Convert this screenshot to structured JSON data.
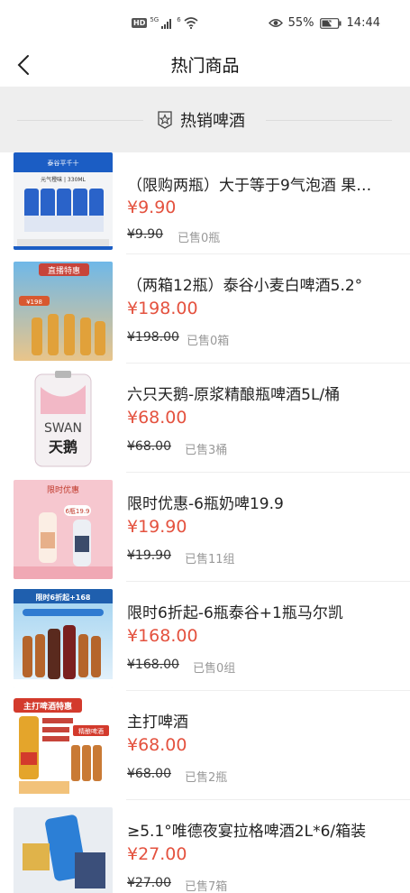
{
  "status_bar": {
    "hd": "HD",
    "network": "5G",
    "wifi_label": "6",
    "battery": "55%",
    "time": "14:44"
  },
  "header": {
    "title": "热门商品"
  },
  "section": {
    "title": "热销啤酒"
  },
  "thumbs": {
    "p1_top": "泰谷平千十",
    "p1_mid": "元气橙味 | 330ML",
    "p2_banner": "直播特惠",
    "p2_price": "¥198",
    "p3_brand": "SWAN",
    "p3_cn": "天鹅",
    "p4_banner": "限时优惠",
    "p4_price": "6瓶19.9",
    "p5_banner": "限时6折起+168",
    "p6_banner": "主打啤酒特惠",
    "p6_tag": "精酿啤酒"
  },
  "products": [
    {
      "title": "（限购两瓶）大于等于9气泡酒 果…",
      "price": "¥9.90",
      "original_price": "¥9.90",
      "sold": "已售0瓶"
    },
    {
      "title": "（两箱12瓶）泰谷小麦白啤酒5.2°",
      "price": "¥198.00",
      "original_price": "¥198.00",
      "sold": "已售0箱"
    },
    {
      "title": "六只天鹅-原浆精酿瓶啤酒5L/桶",
      "price": "¥68.00",
      "original_price": "¥68.00",
      "sold": "已售3桶"
    },
    {
      "title": "限时优惠-6瓶奶啤19.9",
      "price": "¥19.90",
      "original_price": "¥19.90",
      "sold": "已售11组"
    },
    {
      "title": "限时6折起-6瓶泰谷+1瓶马尔凯",
      "price": "¥168.00",
      "original_price": "¥168.00",
      "sold": "已售0组"
    },
    {
      "title": "主打啤酒",
      "price": "¥68.00",
      "original_price": "¥68.00",
      "sold": "已售2瓶"
    },
    {
      "title": "≥5.1°唯德夜宴拉格啤酒2L*6/箱装",
      "price": "¥27.00",
      "original_price": "¥27.00",
      "sold": "已售7箱"
    }
  ],
  "colors": {
    "price": "#e4523f",
    "banner_bg": "#eeeeee"
  }
}
